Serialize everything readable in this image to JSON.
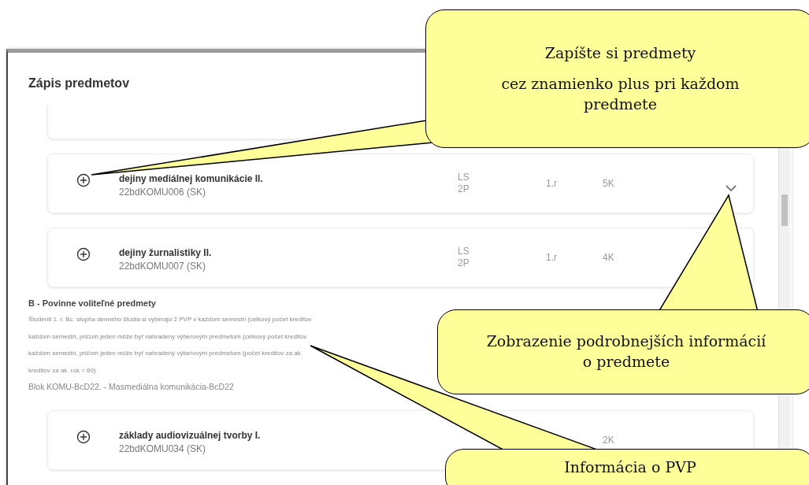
{
  "dialog": {
    "title": "Zápis predmetov"
  },
  "courses": [
    {
      "name": "dejiny mediálnej komunikácie II.",
      "code": "22bdKOMU006 (SK)",
      "semester": "LS",
      "hours": "2P",
      "year": "1.r",
      "credits": "5K",
      "details_toggle": true
    },
    {
      "name": "dejiny žurnalistiky II.",
      "code": "22bdKOMU007 (SK)",
      "semester": "LS",
      "hours": "2P",
      "year": "1.r",
      "credits": "4K",
      "details_toggle": false
    }
  ],
  "section": {
    "heading": "B - Povinne voliteľné predmety",
    "description_lines": [
      "Študenti 1. r. Bc. stupňa denného štúdia si vyberajú 2 PVP v každom semestri (celkový počet kreditov",
      "každom semestri, pričom jeden môže byť nahradený výberovým predmetom (celkový počet kreditov",
      "každom semestri, pričom jeden môže byť nahradený výberovým predmetom (počet kreditov za ak.",
      "kreditov za ak. rok = 60)"
    ],
    "block": "Blok KOMU-BcD22. - Masmediálna komunikácia-BcD22",
    "courses": [
      {
        "name": "základy audiovizuálnej tvorby I.",
        "code": "22bdKOMU034 (SK)",
        "credits": "2K",
        "details_toggle": false
      }
    ]
  },
  "callouts": [
    {
      "paragraphs": [
        "Zapíšte si predmety",
        "cez znamienko plus pri každom predmete"
      ]
    },
    {
      "paragraphs": [
        "Zobrazenie podrobnejších informácií o predmete"
      ]
    },
    {
      "paragraphs": [
        "Informácia o PVP"
      ]
    }
  ]
}
